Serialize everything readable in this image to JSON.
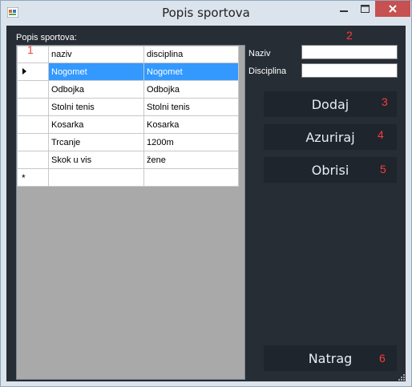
{
  "window": {
    "title": "Popis sportova"
  },
  "grid": {
    "label": "Popis sportova:",
    "columns": [
      "naziv",
      "disciplina"
    ],
    "rows": [
      {
        "naziv": "Nogomet",
        "disciplina": "Nogomet"
      },
      {
        "naziv": "Odbojka",
        "disciplina": "Odbojka"
      },
      {
        "naziv": "Stolni tenis",
        "disciplina": "Stolni tenis"
      },
      {
        "naziv": "Kosarka",
        "disciplina": "Kosarka"
      },
      {
        "naziv": "Trcanje",
        "disciplina": "1200m"
      },
      {
        "naziv": "Skok u vis",
        "disciplina": "žene"
      }
    ],
    "new_row_marker": "*"
  },
  "form": {
    "naziv_label": "Naziv",
    "disciplina_label": "Disciplina",
    "naziv_value": "",
    "disciplina_value": ""
  },
  "buttons": {
    "dodaj": "Dodaj",
    "azuriraj": "Azuriraj",
    "obrisi": "Obrisi",
    "natrag": "Natrag"
  },
  "annotations": [
    "1",
    "2",
    "3",
    "4",
    "5",
    "6"
  ],
  "colors": {
    "client_bg": "#262d35",
    "button_bg": "#1e252c",
    "selection": "#3399ff",
    "annotation": "#ff3b3b",
    "close_button": "#c75050"
  }
}
